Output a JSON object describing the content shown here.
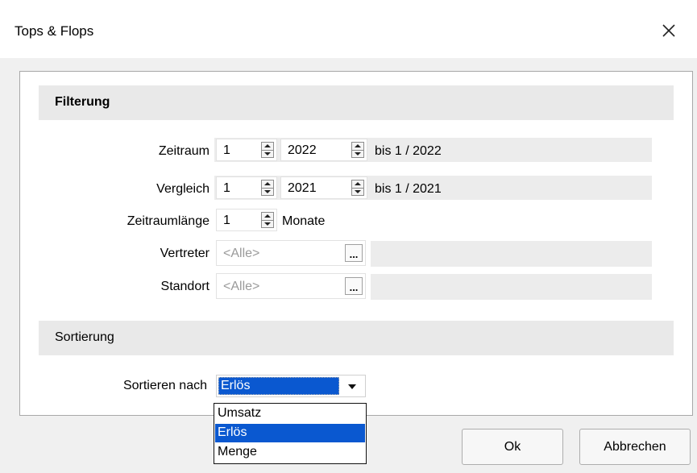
{
  "window": {
    "title": "Tops & Flops"
  },
  "filter": {
    "heading": "Filterung",
    "zeitraum": {
      "label": "Zeitraum",
      "month": "1",
      "year": "2022",
      "range_text": "bis 1 / 2022"
    },
    "vergleich": {
      "label": "Vergleich",
      "month": "1",
      "year": "2021",
      "range_text": "bis 1 / 2021"
    },
    "laenge": {
      "label": "Zeitraumlänge",
      "value": "1",
      "unit": "Monate"
    },
    "vertreter": {
      "label": "Vertreter",
      "placeholder": "<Alle>",
      "button": "..."
    },
    "standort": {
      "label": "Standort",
      "placeholder": "<Alle>",
      "button": "..."
    }
  },
  "sort": {
    "heading": "Sortierung",
    "label": "Sortieren nach",
    "selected": "Erlös",
    "options": [
      "Umsatz",
      "Erlös",
      "Menge"
    ],
    "highlighted_index": 1
  },
  "buttons": {
    "ok": "Ok",
    "cancel": "Abbrechen"
  },
  "colors": {
    "selection": "#0a58d0",
    "section_bg": "#e9e9e9",
    "dialog_bg": "#f0f0f0"
  }
}
